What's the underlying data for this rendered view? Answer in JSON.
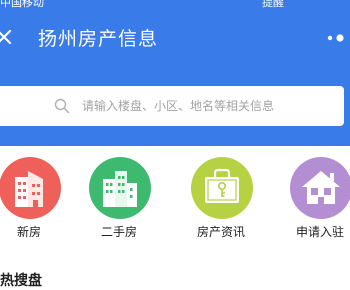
{
  "status_bar": {
    "left_text": "中国移动",
    "right_text": "提醒"
  },
  "header": {
    "title": "扬州房产信息"
  },
  "search": {
    "placeholder": "请输入楼盘、小区、地名等相关信息"
  },
  "menu": [
    {
      "label": "新房",
      "icon": "new-house-icon",
      "color": "#f0605a"
    },
    {
      "label": "二手房",
      "icon": "second-hand-house-icon",
      "color": "#3dba6f"
    },
    {
      "label": "房产资讯",
      "icon": "property-news-icon",
      "color": "#b6d142"
    },
    {
      "label": "申请入驻",
      "icon": "apply-join-icon",
      "color": "#b48ed2"
    }
  ],
  "section": {
    "title": "热搜盘"
  }
}
